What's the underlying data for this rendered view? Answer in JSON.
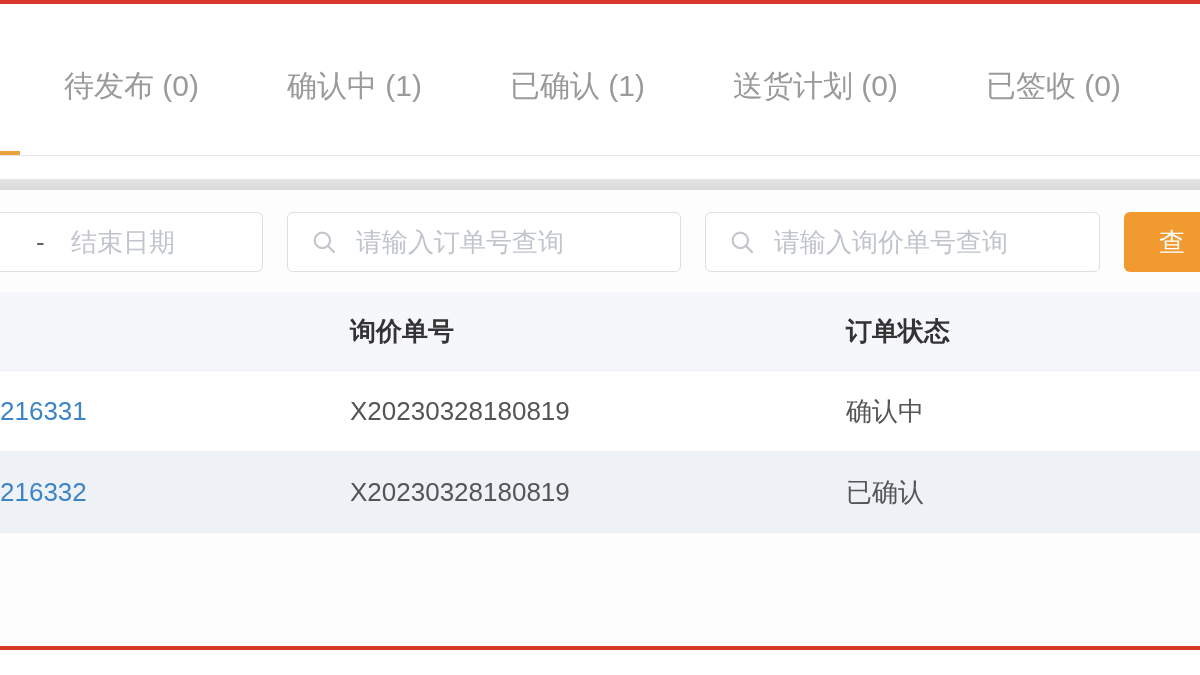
{
  "tabs": [
    {
      "selected": true
    },
    {
      "label": "待发布 (0)",
      "selected": false
    },
    {
      "label": "确认中 (1)",
      "selected": false
    },
    {
      "label": "已确认 (1)",
      "selected": false
    },
    {
      "label": "送货计划 (0)",
      "selected": false
    },
    {
      "label": "已签收 (0)",
      "selected": false
    }
  ],
  "filters": {
    "date_range": {
      "separator": "-",
      "end_placeholder": "结束日期"
    },
    "order_search": {
      "placeholder": "请输入订单号查询"
    },
    "inquiry_search": {
      "placeholder": "请输入询价单号查询"
    },
    "query_button": "查"
  },
  "table": {
    "columns": [
      {
        "kind": "link"
      },
      {
        "kind": "text",
        "heading": "询价单号"
      },
      {
        "kind": "text",
        "heading": "订单状态"
      }
    ],
    "rows": [
      {
        "cells": [
          "216331",
          "X20230328180819",
          "确认中"
        ],
        "highlighted": false
      },
      {
        "cells": [
          "216332",
          "X20230328180819",
          "已确认"
        ],
        "highlighted": true
      }
    ]
  }
}
